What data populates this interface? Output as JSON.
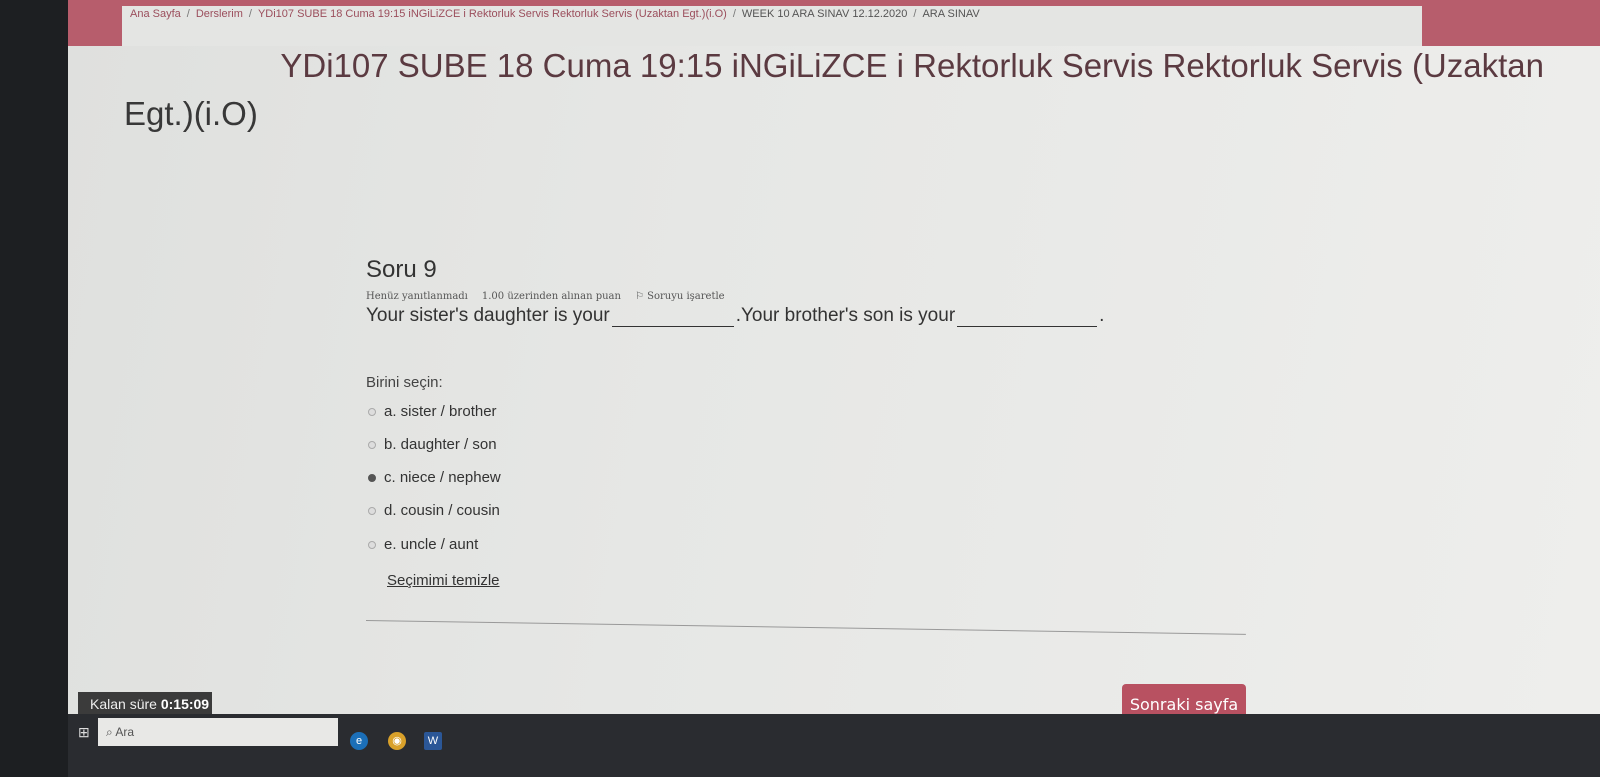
{
  "breadcrumb": [
    "Ana Sayfa",
    "Derslerim",
    "YDi107 SUBE 18 Cuma 19:15 iNGiLiZCE i Rektorluk Servis Rektorluk Servis (Uzaktan Egt.)(i.O)",
    "WEEK 10 ARA SINAV 12.12.2020",
    "ARA SINAV"
  ],
  "breadcrumb_sep": "/",
  "course": {
    "title_line1": "YDi107 SUBE 18 Cuma 19:15 iNGiLiZCE i Rektorluk Servis Rektorluk Servis (Uzaktan",
    "title_line2": "Egt.)(i.O)"
  },
  "question": {
    "number": "Soru 9",
    "status": "Henüz yanıtlanmadı",
    "points": "1.00 üzerinden alınan puan",
    "flag": "Soruyu işaretle",
    "text_part1": "Your sister's daughter is your",
    "text_part2": ".Your brother's son is your",
    "text_end": ".",
    "choose_label": "Birini seçin:",
    "options": [
      {
        "label": "a. sister / brother",
        "checked": false
      },
      {
        "label": "b. daughter / son",
        "checked": false
      },
      {
        "label": "c. niece / nephew",
        "checked": true
      },
      {
        "label": "d. cousin / cousin",
        "checked": false
      },
      {
        "label": "e. uncle / aunt",
        "checked": false
      }
    ],
    "clear_label": "Seçimimi temizle"
  },
  "timer": {
    "label": "Kalan süre",
    "value": "0:15:09"
  },
  "next_button": "Sonraki sayfa",
  "taskbar": {
    "search_placeholder": "Ara"
  }
}
